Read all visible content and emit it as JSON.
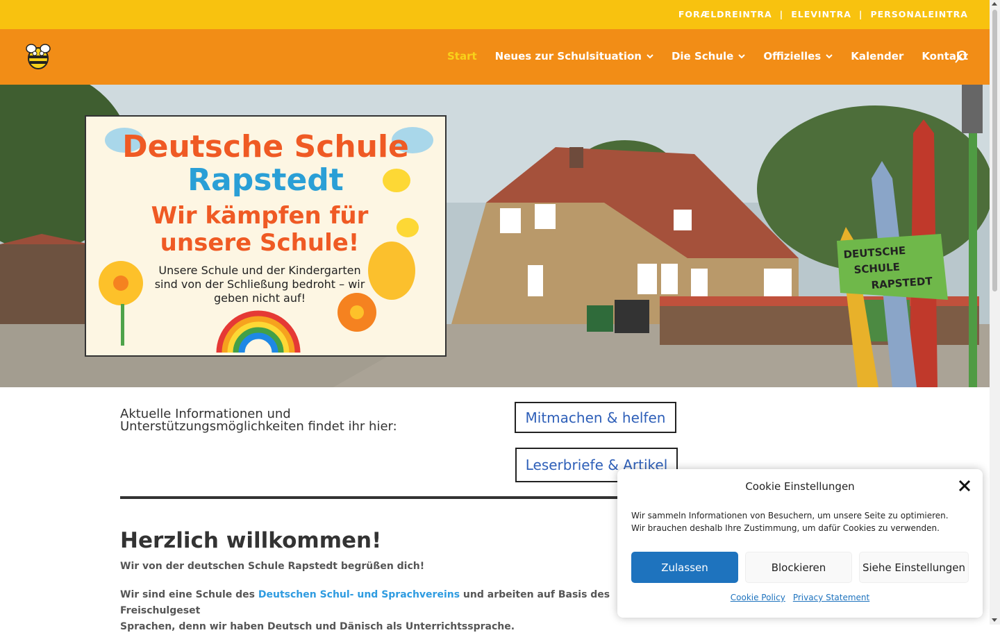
{
  "topbar": {
    "links": [
      "FORÆLDREINTRA",
      "ELEVINTRA",
      "PERSONALEINTRA"
    ],
    "separator": "|"
  },
  "nav": {
    "items": [
      {
        "label": "Start",
        "active": true,
        "dropdown": false
      },
      {
        "label": "Neues zur Schulsituation",
        "active": false,
        "dropdown": true
      },
      {
        "label": "Die Schule",
        "active": false,
        "dropdown": true
      },
      {
        "label": "Offizielles",
        "active": false,
        "dropdown": true
      },
      {
        "label": "Kalender",
        "active": false,
        "dropdown": false
      },
      {
        "label": "Kontakt",
        "active": false,
        "dropdown": false
      }
    ],
    "chevron": "❯",
    "search_icon": "search-icon"
  },
  "hero": {
    "poster": {
      "line1": "Deutsche Schule",
      "line2": "Rapstedt",
      "headline": "Wir kämpfen für unsere Schule!",
      "subtext": "Unsere Schule und der Kindergarten sind von der Schließung bedroht – wir geben nicht auf!"
    },
    "sign": "DEUTSCHE SCHULE RAPSTEDT"
  },
  "main": {
    "intro": "Aktuelle Informationen und Unterstützungsmöglichkeiten findet ihr hier:",
    "buttons": [
      "Mitmachen & helfen",
      "Leserbriefe & Artikel"
    ],
    "welcome_title": "Herzlich willkommen!",
    "welcome_sub": "Wir von der deutschen Schule Rapstedt begrüßen dich!",
    "para_start": "Wir sind eine Schule des ",
    "para_link": "Deutschen Schul- und Sprachvereins",
    "para_rest": " und arbeiten auf Basis des Freischulgeset",
    "para_line2": "Sprachen, denn wir haben Deutsch und Dänisch als Unterrichtssprache."
  },
  "cookie": {
    "title": "Cookie Einstellungen",
    "message": "Wir sammeln Informationen von Besuchern, um unsere Seite zu optimieren. Wir brauchen deshalb Ihre Zustimmung, um dafür Cookies zu verwenden.",
    "accept": "Zulassen",
    "deny": "Blockieren",
    "settings": "Siehe Einstellungen",
    "policy": "Cookie Policy",
    "privacy": "Privacy Statement",
    "colors": {
      "accept_bg": "#1e73be",
      "secondary_bg": "#f9f9f9"
    }
  },
  "colors": {
    "topbar": "#f8c20f",
    "nav": "#f28d16",
    "active": "#f8d21a",
    "button_text": "#2e5fb8"
  }
}
